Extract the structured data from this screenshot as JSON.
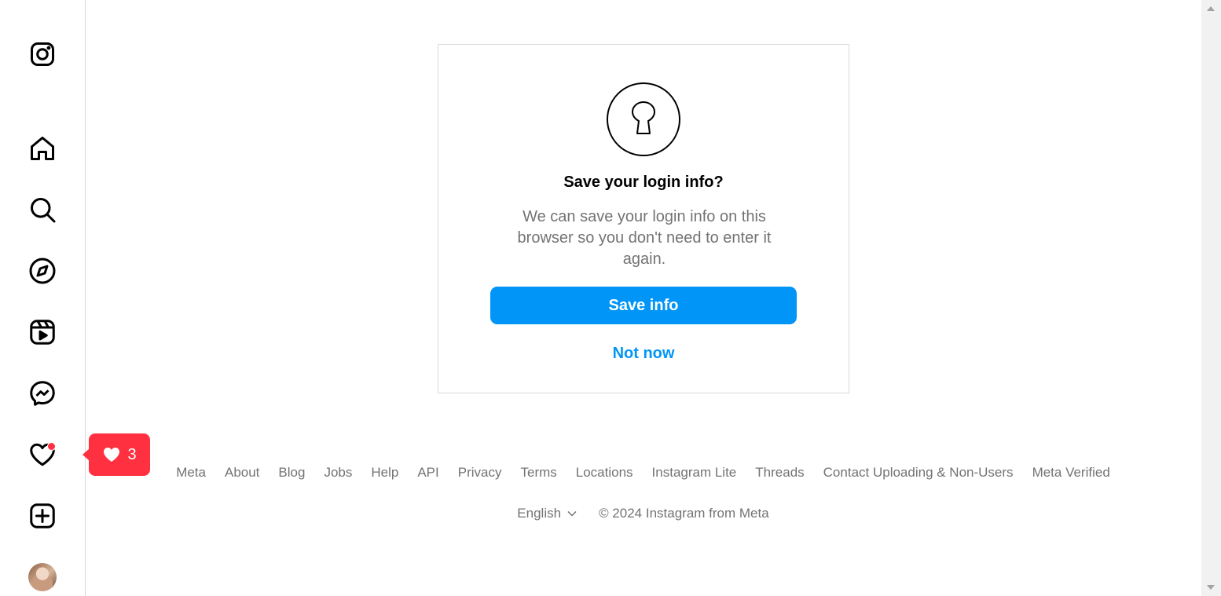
{
  "sidebar": {
    "items": [
      {
        "name": "instagram-logo-icon"
      },
      {
        "name": "home-icon"
      },
      {
        "name": "search-icon"
      },
      {
        "name": "explore-compass-icon"
      },
      {
        "name": "reels-icon"
      },
      {
        "name": "messenger-icon"
      },
      {
        "name": "notifications-heart-icon"
      },
      {
        "name": "create-plus-icon"
      },
      {
        "name": "profile-avatar"
      }
    ],
    "notification_badge_color": "#ff3040"
  },
  "notification_tooltip": {
    "icon": "heart-icon",
    "count": "3"
  },
  "dialog": {
    "icon": "keyhole-lock-icon",
    "title": "Save your login info?",
    "body": "We can save your login info on this browser so you don't need to enter it again.",
    "primary_button": "Save info",
    "secondary_button": "Not now",
    "primary_color": "#0095f6"
  },
  "footer": {
    "links": [
      "Meta",
      "About",
      "Blog",
      "Jobs",
      "Help",
      "API",
      "Privacy",
      "Terms",
      "Locations",
      "Instagram Lite",
      "Threads",
      "Contact Uploading & Non-Users",
      "Meta Verified"
    ],
    "language": "English",
    "copyright": "© 2024 Instagram from Meta"
  }
}
